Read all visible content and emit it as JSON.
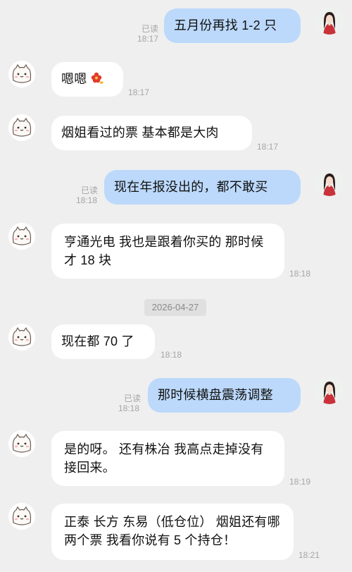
{
  "messages": [
    {
      "side": "right",
      "text": "五月份再找 1-2 只",
      "time": "18:17",
      "status": "已读"
    },
    {
      "side": "left",
      "text": "嗯嗯",
      "emoji": "flower-emoji",
      "time": "18:17"
    },
    {
      "side": "left",
      "text": "烟姐看过的票 基本都是大肉",
      "time": "18:17"
    },
    {
      "side": "right",
      "text": "现在年报没出的，都不敢买",
      "time": "18:18",
      "status": "已读"
    },
    {
      "side": "left",
      "text": "亨通光电 我也是跟着你买的 那时候才 18 块",
      "time": "18:18"
    },
    {
      "side": "left",
      "text": "现在都 70 了",
      "time": "18:18"
    },
    {
      "side": "right",
      "text": "那时候横盘震荡调整",
      "time": "18:18",
      "status": "已读"
    },
    {
      "side": "left",
      "text": "是的呀。 还有株冶 我高点走掉没有接回来。",
      "time": "18:19"
    },
    {
      "side": "left",
      "text": "正泰 长方 东易（低仓位） 烟姐还有哪两个票 我看你说有 5 个持仓！",
      "time": "18:21"
    }
  ],
  "date_divider": "2026-04-27",
  "colors": {
    "background": "#efefef",
    "bubble_left": "#ffffff",
    "bubble_right": "#bcd9fb",
    "meta_text": "#a5a5a5"
  },
  "icons": {
    "other_avatar": "cat-avatar-icon",
    "self_avatar": "woman-avatar-icon",
    "emoji": "flower-emoji-icon"
  }
}
